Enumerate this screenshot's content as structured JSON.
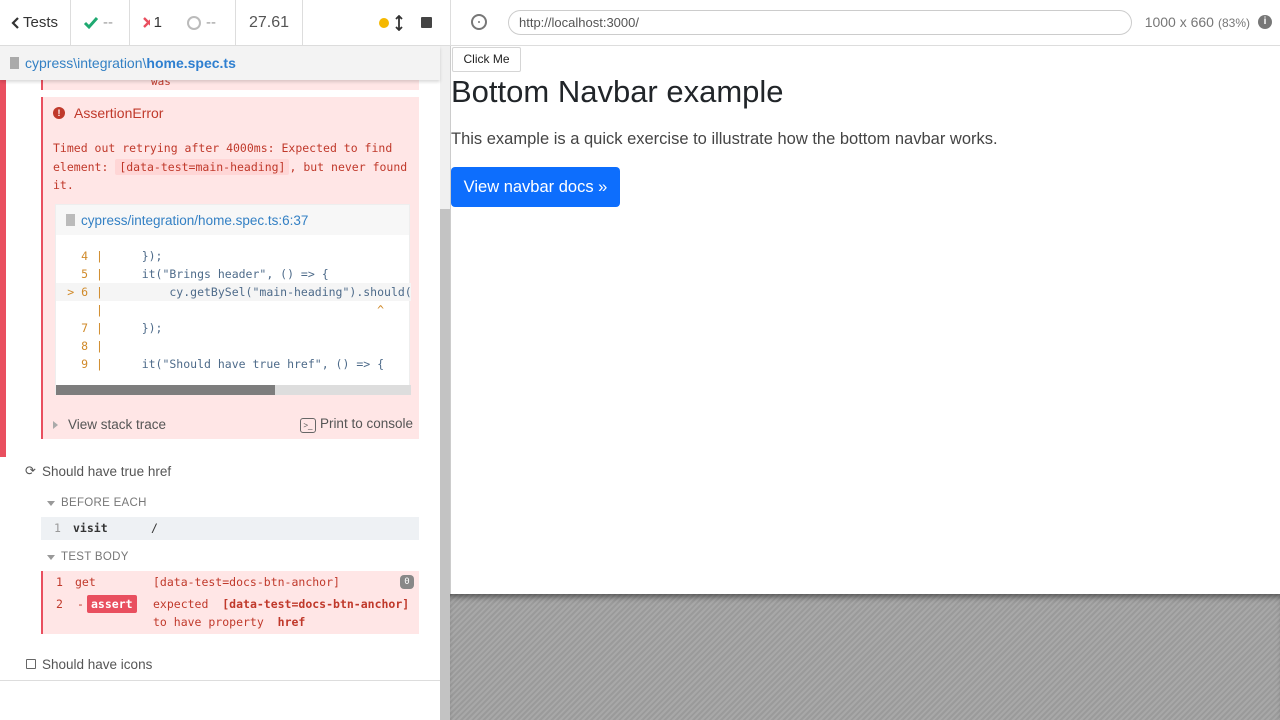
{
  "stats": {
    "tests_label": "Tests",
    "passed": "--",
    "failed": "1",
    "pending": "--",
    "duration": "27.61"
  },
  "spec": {
    "dir": "cypress\\integration\\",
    "file": "home.spec.ts"
  },
  "error": {
    "prev_text": "was",
    "title": "AssertionError",
    "msg_part1": "Timed out retrying after 4000ms: Expected to find element: ",
    "msg_code": "[data-test=main-heading]",
    "msg_part2": ", but never found it.",
    "frame_path": "cypress/integration/home.spec.ts:6:37",
    "code_lines": [
      {
        "ln": "4",
        "src": "    });"
      },
      {
        "ln": "5",
        "src": "    it(\"Brings header\", () => {"
      },
      {
        "ln": "> 6",
        "src": "        cy.getBySel(\"main-heading\").should("
      },
      {
        "ln": "",
        "src": "                                      ^"
      },
      {
        "ln": "7",
        "src": "    });"
      },
      {
        "ln": "8",
        "src": ""
      },
      {
        "ln": "9",
        "src": "    it(\"Should have true href\", () => {"
      }
    ],
    "view_stack": "View stack trace",
    "print_console": "Print to console"
  },
  "test2": {
    "title": "Should have true href",
    "before_each": "BEFORE EACH",
    "visit_num": "1",
    "visit_name": "visit",
    "visit_msg": "/",
    "test_body": "TEST BODY",
    "get_num": "1",
    "get_name": "get",
    "get_msg": "[data-test=docs-btn-anchor]",
    "get_count": "0",
    "assert_num": "2",
    "assert_dash": "-",
    "assert_name": "assert",
    "assert_msg1": "expected",
    "assert_msg_sel": "[data-test=docs-btn-anchor]",
    "assert_msg2": "to have property",
    "assert_prop": "href"
  },
  "test3": {
    "title": "Should have icons"
  },
  "aut": {
    "url": "http://localhost:3000/",
    "viewport": "1000 x 660",
    "zoom": "(83%)",
    "click_me": "Click Me",
    "heading": "Bottom Navbar example",
    "lead": "This example is a quick exercise to illustrate how the bottom navbar works.",
    "docs_button": "View navbar docs »"
  },
  "colors": {
    "fail": "#e94f5f",
    "pass": "#1fa971",
    "link": "#3380c4",
    "primary_button": "#0d6efd"
  }
}
